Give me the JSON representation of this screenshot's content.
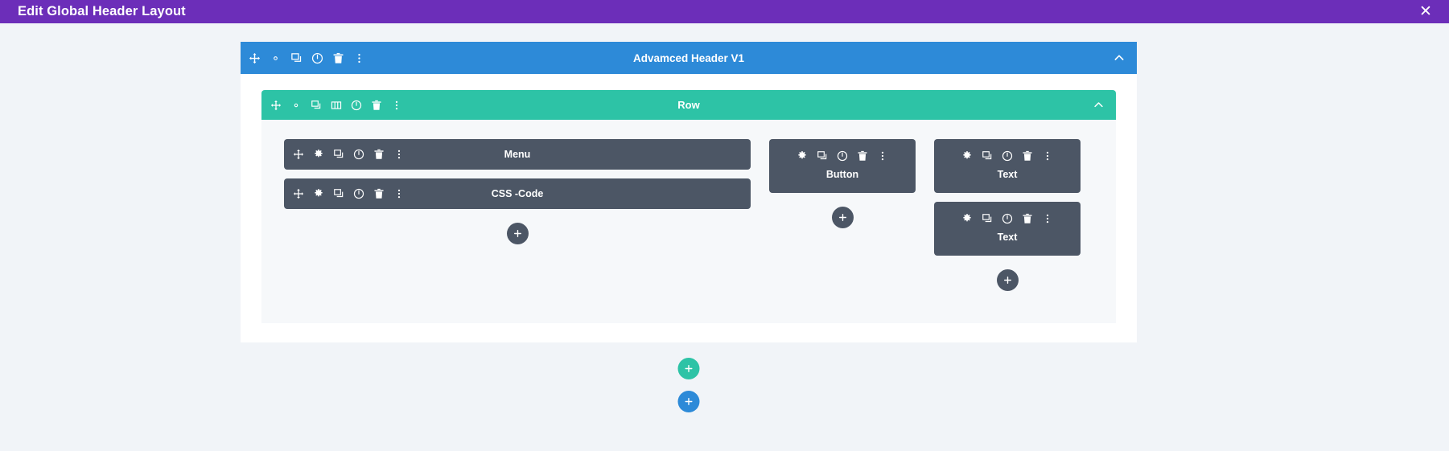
{
  "topbar": {
    "title": "Edit Global Header Layout",
    "close_label": "✕",
    "bg_color": "#6c2eb9"
  },
  "section": {
    "title": "Advamced Header V1",
    "bg_color": "#2d8ad8",
    "collapse_icon": "chevron-up-icon",
    "toolbar_icons": [
      "move-icon",
      "gear-icon",
      "duplicate-icon",
      "power-icon",
      "trash-icon",
      "kebab-menu-icon"
    ]
  },
  "row": {
    "title": "Row",
    "bg_color": "#2dc3a6",
    "collapse_icon": "chevron-up-icon",
    "toolbar_icons": [
      "move-icon",
      "gear-icon",
      "duplicate-icon",
      "columns-icon",
      "power-icon",
      "trash-icon",
      "kebab-menu-icon"
    ]
  },
  "module_bg_color": "#4c5665",
  "columns": [
    {
      "name": "column-one",
      "modules": [
        {
          "label": "Menu",
          "layout": "horizontal",
          "icons": [
            "move-icon",
            "gear-icon",
            "duplicate-icon",
            "power-icon",
            "trash-icon",
            "kebab-menu-icon"
          ]
        },
        {
          "label": "CSS -Code",
          "layout": "horizontal",
          "icons": [
            "move-icon",
            "gear-icon",
            "duplicate-icon",
            "power-icon",
            "trash-icon",
            "kebab-menu-icon"
          ]
        }
      ],
      "add_label": "+"
    },
    {
      "name": "column-two",
      "modules": [
        {
          "label": "Button",
          "layout": "stacked",
          "icons": [
            "gear-icon",
            "duplicate-icon",
            "power-icon",
            "trash-icon",
            "kebab-menu-icon"
          ]
        }
      ],
      "add_label": "+"
    },
    {
      "name": "column-three",
      "modules": [
        {
          "label": "Text",
          "layout": "stacked",
          "icons": [
            "gear-icon",
            "duplicate-icon",
            "power-icon",
            "trash-icon",
            "kebab-menu-icon"
          ]
        },
        {
          "label": "Text",
          "layout": "stacked",
          "icons": [
            "gear-icon",
            "duplicate-icon",
            "power-icon",
            "trash-icon",
            "kebab-menu-icon"
          ]
        }
      ],
      "add_label": "+"
    }
  ],
  "add_buttons": {
    "add_row_label": "+",
    "add_row_color": "#2dc3a6",
    "add_section_label": "+",
    "add_section_color": "#2d8ad8",
    "add_module_color": "#4c5665"
  }
}
